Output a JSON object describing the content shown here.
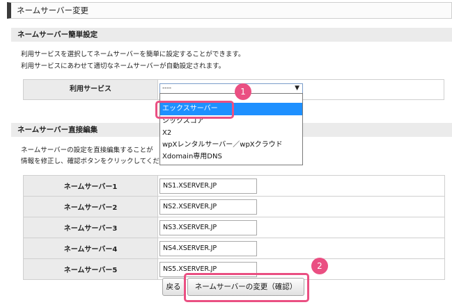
{
  "page_title": "ネームサーバー変更",
  "simple_section": {
    "title": "ネームサーバー簡単設定",
    "desc_lines": [
      "利用サービスを選択してネームサーバーを簡単に設定することができます。",
      "利用サービスにあわせて適切なネームサーバーが自動設定されます。"
    ],
    "service_label": "利用サービス",
    "select_value": "----",
    "options": [
      "エックスサーバー",
      "シックスコア",
      "X2",
      "wpXレンタルサーバー／wpXクラウド",
      "Xdomain専用DNS"
    ]
  },
  "direct_section": {
    "title": "ネームサーバー直接編集",
    "desc_lines": [
      "ネームサーバーの設定を直接編集することが",
      "情報を修正し、確認ボタンをクリックしてくださ"
    ],
    "rows": [
      {
        "label": "ネームサーバー1",
        "value": "NS1.XSERVER.JP"
      },
      {
        "label": "ネームサーバー2",
        "value": "NS2.XSERVER.JP"
      },
      {
        "label": "ネームサーバー3",
        "value": "NS3.XSERVER.JP"
      },
      {
        "label": "ネームサーバー4",
        "value": "NS4.XSERVER.JP"
      },
      {
        "label": "ネームサーバー5",
        "value": "NS5.XSERVER.JP"
      }
    ]
  },
  "buttons": {
    "back": "戻る",
    "submit": "ネームサーバーの変更（確認）"
  },
  "annotations": {
    "badge_1": "1",
    "badge_2": "2",
    "highlight_color": "#ea4f82"
  },
  "accent_color": "#1e90ff"
}
